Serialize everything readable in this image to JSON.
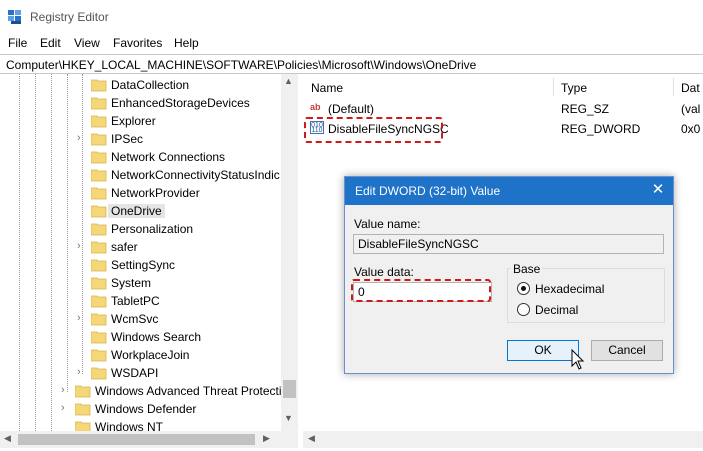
{
  "window": {
    "title": "Registry Editor"
  },
  "menu": [
    "File",
    "Edit",
    "View",
    "Favorites",
    "Help"
  ],
  "address": "Computer\\HKEY_LOCAL_MACHINE\\SOFTWARE\\Policies\\Microsoft\\Windows\\OneDrive",
  "tree": {
    "items": [
      {
        "label": "DataCollection"
      },
      {
        "label": "EnhancedStorageDevices"
      },
      {
        "label": "Explorer"
      },
      {
        "label": "IPSec"
      },
      {
        "label": "Network Connections"
      },
      {
        "label": "NetworkConnectivityStatusIndic"
      },
      {
        "label": "NetworkProvider"
      },
      {
        "label": "OneDrive"
      },
      {
        "label": "Personalization"
      },
      {
        "label": "safer"
      },
      {
        "label": "SettingSync"
      },
      {
        "label": "System"
      },
      {
        "label": "TabletPC"
      },
      {
        "label": "WcmSvc"
      },
      {
        "label": "Windows Search"
      },
      {
        "label": "WorkplaceJoin"
      },
      {
        "label": "WSDAPI"
      },
      {
        "label": "Windows Advanced Threat Protecti"
      },
      {
        "label": "Windows Defender"
      },
      {
        "label": "Windows NT"
      }
    ],
    "selected": "OneDrive"
  },
  "list": {
    "columns": [
      "Name",
      "Type",
      "Dat"
    ],
    "rows": [
      {
        "name": "(Default)",
        "type": "REG_SZ",
        "data": "(val",
        "icon": "string-value-icon"
      },
      {
        "name": "DisableFileSyncNGSC",
        "type": "REG_DWORD",
        "data": "0x0",
        "icon": "dword-value-icon"
      }
    ]
  },
  "dialog": {
    "title": "Edit DWORD (32-bit) Value",
    "value_name_label": "Value name:",
    "value_name": "DisableFileSyncNGSC",
    "value_data_label": "Value data:",
    "value_data": "0",
    "base_label": "Base",
    "base_options": [
      "Hexadecimal",
      "Decimal"
    ],
    "base_selected": "Hexadecimal",
    "ok_label": "OK",
    "cancel_label": "Cancel"
  },
  "colors": {
    "dialog_title_bar": "#1e73c8",
    "highlight_box": "#d01a1a",
    "folder": "#f5d77a"
  }
}
